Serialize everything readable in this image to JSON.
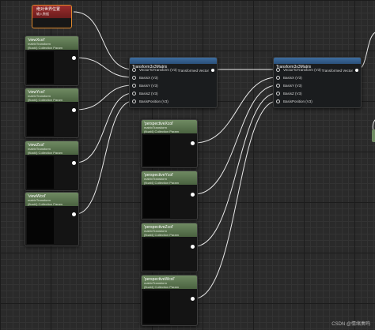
{
  "param_node": {
    "title": "绝对世界位置",
    "subtitle": "输入数据"
  },
  "view_nodes": [
    {
      "title": "'viewXcol'",
      "sub1": "matrixTransform",
      "sub2": "(float4) Collection Param"
    },
    {
      "title": "'viewYcol'",
      "sub1": "matrixTransform",
      "sub2": "(float4) Collection Param"
    },
    {
      "title": "'viewZcol'",
      "sub1": "matrixTransform",
      "sub2": "(float4) Collection Param"
    },
    {
      "title": "'viewWcol'",
      "sub1": "matrixTransform",
      "sub2": "(float4) Collection Param"
    }
  ],
  "perspective_nodes": [
    {
      "title": "'perspectiveXcol'",
      "sub1": "matrixTransform",
      "sub2": "(float4) Collection Param"
    },
    {
      "title": "'perspectiveYcol'",
      "sub1": "matrixTransform",
      "sub2": "(float4) Collection Param"
    },
    {
      "title": "'perspectiveZcol'",
      "sub1": "matrixTransform",
      "sub2": "(float4) Collection Param"
    },
    {
      "title": "'perspectiveWcol'",
      "sub1": "matrixTransform",
      "sub2": "(float4) Collection Param"
    }
  ],
  "transform_nodes": [
    {
      "title": "Transform3x3Matrix",
      "inputs": [
        "VectorToTransform (V3)",
        "BasisX (V3)",
        "BasisY (V3)",
        "BasisZ (V3)",
        "BasisPosition (V3)"
      ],
      "output": "Transformed Vector"
    },
    {
      "title": "Transform3x3Matrix",
      "inputs": [
        "VectorToTransform (V3)",
        "BasisX (V3)",
        "BasisY (V3)",
        "BasisZ (V3)",
        "BasisPosition (V3)"
      ],
      "output": "Transformed Vector"
    }
  ],
  "watermark": "CSDN @情绪奏鸣",
  "colors": {
    "wire": "#e8e8e8",
    "param_border": "#e08a2e",
    "collection_header": "#5f7a52",
    "function_header": "#355f8c",
    "canvas": "#2a2a2a"
  }
}
